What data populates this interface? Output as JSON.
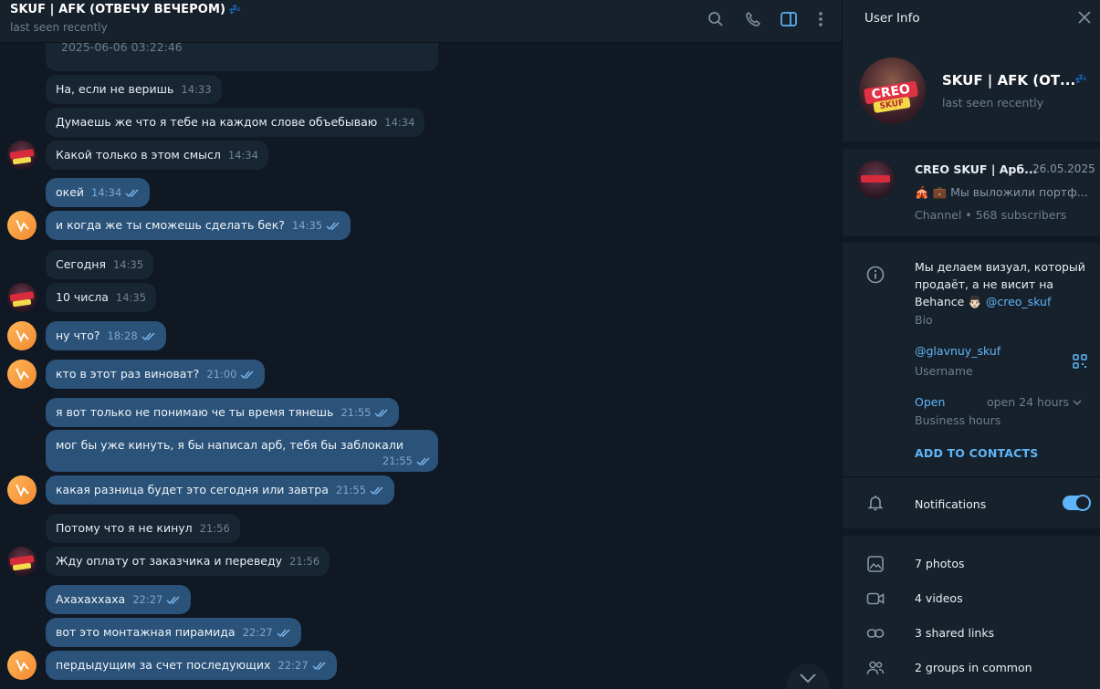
{
  "header": {
    "title": "SKUF | AFK (ОТВЕЧУ ВЕЧЕРОМ)",
    "title_emoji": "💤",
    "status": "last seen recently"
  },
  "messages": [
    {
      "dir": "in",
      "text": "2025-06-06 03:22:46",
      "time": ""
    },
    {
      "dir": "in",
      "text": "На, если не веришь",
      "time": "14:33"
    },
    {
      "dir": "in",
      "text": "Думаешь же что я тебе на каждом слове объебываю",
      "time": "14:34"
    },
    {
      "dir": "in",
      "text": "Какой только в этом смысл",
      "time": "14:34"
    },
    {
      "dir": "out",
      "text": "окей",
      "time": "14:34"
    },
    {
      "dir": "out",
      "text": "и когда же ты сможешь сделать бек?",
      "time": "14:35"
    },
    {
      "dir": "in",
      "text": "Сегодня",
      "time": "14:35"
    },
    {
      "dir": "in",
      "text": "10 числа",
      "time": "14:35"
    },
    {
      "dir": "out",
      "text": "ну что?",
      "time": "18:28"
    },
    {
      "dir": "out",
      "text": "кто в этот раз виноват?",
      "time": "21:00"
    },
    {
      "dir": "out",
      "text": "я вот только не понимаю че ты время тянешь",
      "time": "21:55"
    },
    {
      "dir": "out",
      "text": "мог бы уже кинуть, я бы написал арб, тебя бы заблокали",
      "time": "21:55"
    },
    {
      "dir": "out",
      "text": "какая разница будет это сегодня или завтра",
      "time": "21:55"
    },
    {
      "dir": "in",
      "text": "Потому что я не кинул",
      "time": "21:56"
    },
    {
      "dir": "in",
      "text": "Жду оплату от заказчика и переведу",
      "time": "21:56"
    },
    {
      "dir": "out",
      "text": "Ахахаххаха",
      "time": "22:27"
    },
    {
      "dir": "out",
      "text": "вот это монтажная пирамида",
      "time": "22:27"
    },
    {
      "dir": "out",
      "text": "пердыдущим за счет последующих",
      "time": "22:27"
    }
  ],
  "avatars": {
    "creo_text_1": "CREO",
    "creo_text_2": "SKUF"
  },
  "panel": {
    "title": "User Info",
    "name": "SKUF | AFK (ОТ...",
    "name_emoji": "💤",
    "status": "last seen recently",
    "channel": {
      "name": "CREO SKUF | Арб...",
      "date": "26.05.2025",
      "preview": "🎪 💼 Мы выложили портф...",
      "subscribers": "Channel • 568 subscribers"
    },
    "bio_text": "Мы делаем визуал, который продаёт, а не висит на Behance 👨🏻",
    "bio_link": "@creo_skuf",
    "bio_label": "Bio",
    "username": "@glavnuy_skuf",
    "username_label": "Username",
    "business_open": "Open",
    "business_hours": "open 24 hours",
    "business_label": "Business hours",
    "add_contacts": "ADD TO CONTACTS",
    "notifications": "Notifications",
    "notifications_on": true,
    "media": [
      {
        "icon": "photo-icon",
        "label": "7 photos"
      },
      {
        "icon": "video-icon",
        "label": "4 videos"
      },
      {
        "icon": "link-icon",
        "label": "3 shared links"
      },
      {
        "icon": "groups-icon",
        "label": "2 groups in common"
      }
    ]
  },
  "colors": {
    "accent": "#5eb5f7",
    "outgoing": "#2b5278",
    "incoming": "#182533",
    "background": "#0e1621",
    "panel": "#17212b"
  }
}
